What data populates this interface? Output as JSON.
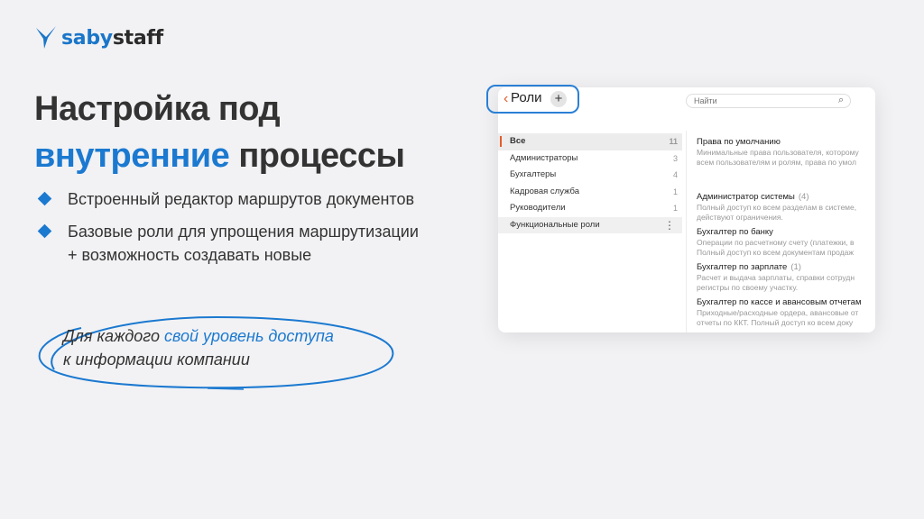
{
  "logo": {
    "saby": "saby",
    "staff": "staff",
    "brand_color": "#1a76c9"
  },
  "title": {
    "line1": "Настройка под",
    "accent": "внутренние",
    "rest": " процессы"
  },
  "bullets": [
    {
      "text": "Встроенный редактор маршрутов документов"
    },
    {
      "line1": "Базовые роли для упрощения маршрутизации",
      "line2": "+ возможность создавать новые"
    }
  ],
  "callout": {
    "prefix": "Для каждого ",
    "accent": "свой уровень доступа",
    "line2": "к информации компании"
  },
  "app": {
    "header": {
      "back": "‹",
      "title": "Роли",
      "add": "+",
      "search_placeholder": "Найти"
    },
    "left_list": [
      {
        "label": "Все",
        "count": "11"
      },
      {
        "label": "Администраторы",
        "count": "3"
      },
      {
        "label": "Бухгалтеры",
        "count": "4"
      },
      {
        "label": "Кадровая служба",
        "count": "1"
      },
      {
        "label": "Руководители",
        "count": "1"
      },
      {
        "label": "Функциональные роли",
        "count": ""
      }
    ],
    "roles": [
      {
        "title": "Права по умолчанию",
        "count": "",
        "desc1": "Минимальные права пользователя, которому",
        "desc2": "всем пользователям и ролям, права по умол"
      },
      {
        "title": "Администратор системы",
        "count": "(4)",
        "desc1": "Полный доступ ко всем разделам в системе,",
        "desc2": "действуют ограничения."
      },
      {
        "title": "Бухгалтер по банку",
        "count": "",
        "desc1": "Операции по расчетному счету (платежки, в",
        "desc2": "Полный доступ ко всем документам продаж"
      },
      {
        "title": "Бухгалтер по зарплате",
        "count": "(1)",
        "desc1": "Расчет и выдача зарплаты, справки сотрудн",
        "desc2": "регистры по своему участку."
      },
      {
        "title": "Бухгалтер по кассе и авансовым отчетам",
        "count": "",
        "desc1": "Приходные/расходные ордера, авансовые от",
        "desc2": "отчеты по ККТ. Полный доступ ко всем доку"
      }
    ],
    "accent_color": "#e45c2b"
  }
}
